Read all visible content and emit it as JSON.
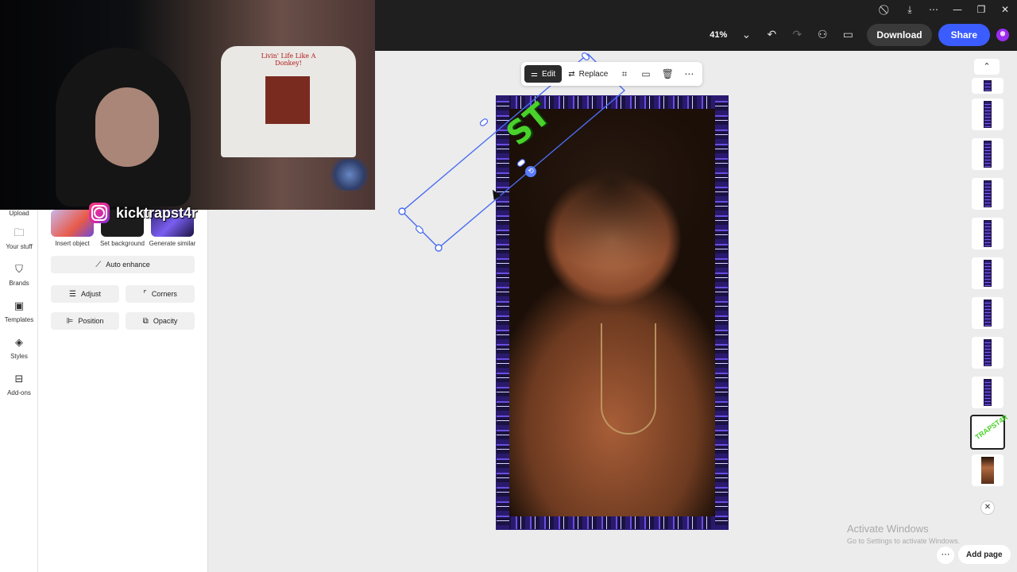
{
  "window_controls": [
    "—",
    "❐",
    "✕"
  ],
  "toolbar": {
    "zoom": "41%",
    "download": "Download",
    "share": "Share",
    "accent": "#3b5cff"
  },
  "rail": {
    "items": [
      {
        "label": "Upload",
        "icon": "upload-icon"
      },
      {
        "label": "Your stuff",
        "icon": "folder-icon"
      },
      {
        "label": "Brands",
        "icon": "brand-icon"
      },
      {
        "label": "Templates",
        "icon": "templates-icon"
      },
      {
        "label": "Styles",
        "icon": "styles-icon"
      },
      {
        "label": "Add-ons",
        "icon": "addons-icon"
      }
    ]
  },
  "panel": {
    "tiles": [
      "Insert object",
      "Set background",
      "Generate similar"
    ],
    "auto_enhance": "Auto enhance",
    "adjust": "Adjust",
    "corners": "Corners",
    "position": "Position",
    "opacity": "Opacity"
  },
  "overlay": {
    "handle": "kicktrapst4r",
    "shirt_text": "Livin' Life Like A Donkey!"
  },
  "context_toolbar": {
    "edit": "Edit",
    "replace": "Replace"
  },
  "thumbnails_count": 11,
  "activate": {
    "title": "Activate Windows",
    "subtitle": "Go to Settings to activate Windows."
  },
  "add_page": "Add page"
}
